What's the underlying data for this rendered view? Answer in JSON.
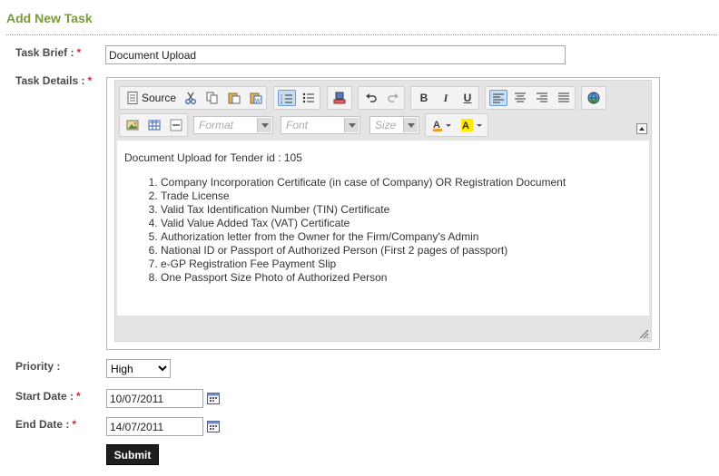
{
  "page": {
    "title": "Add New Task"
  },
  "form": {
    "required_mark": "*",
    "task_brief": {
      "label": "Task Brief :",
      "value": "Document Upload"
    },
    "task_details": {
      "label": "Task Details :"
    },
    "priority": {
      "label": "Priority :",
      "selected": "High"
    },
    "start_date": {
      "label": "Start Date :",
      "value": "10/07/2011"
    },
    "end_date": {
      "label": "End Date :",
      "value": "14/07/2011"
    },
    "submit_label": "Submit"
  },
  "editor": {
    "toolbar": {
      "source_label": "Source",
      "format_placeholder": "Format",
      "font_placeholder": "Font",
      "size_placeholder": "Size",
      "bold": "B",
      "italic": "I",
      "underline": "U"
    },
    "content": {
      "heading": "Document Upload for Tender id : 105",
      "items": [
        "Company Incorporation Certificate (in case of Company) OR Registration Document",
        "Trade License",
        "Valid Tax Identification Number (TIN) Certificate",
        "Valid Value Added Tax (VAT) Certificate",
        "Authorization letter from the Owner for the Firm/Company's Admin",
        "National ID or Passport of Authorized Person (First 2 pages of passport)",
        "e-GP Registration Fee Payment Slip",
        "One Passport Size Photo of Authorized Person"
      ]
    }
  },
  "colors": {
    "title": "#7a9a3c",
    "required": "#dd2233",
    "submit_bg": "#1e1e1e",
    "active_button": "#c8ddf3"
  }
}
